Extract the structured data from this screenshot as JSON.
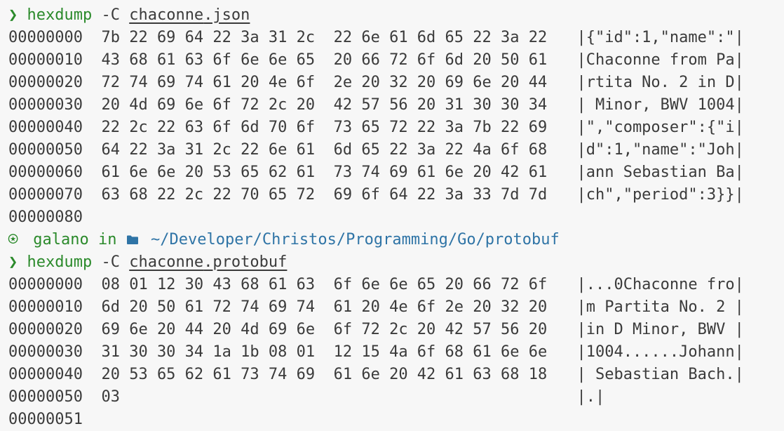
{
  "prompt_symbol": "❯",
  "commands": [
    {
      "cmd": "hexdump",
      "flag": "-C",
      "file_base": "chaconne",
      "file_ext": ".json"
    },
    {
      "cmd": "hexdump",
      "flag": "-C",
      "file_base": "chaconne",
      "file_ext": ".protobuf"
    }
  ],
  "prompt_context": {
    "user_icon": "user-circle-icon",
    "user": "galano",
    "in_word": "in",
    "folder_icon": "folder-icon",
    "path": "~/Developer/Christos/Programming/Go/protobuf"
  },
  "json_dump": [
    {
      "off": "00000000",
      "hex": "7b 22 69 64 22 3a 31 2c  22 6e 61 6d 65 22 3a 22",
      "ascii": "|{\"id\":1,\"name\":\"|"
    },
    {
      "off": "00000010",
      "hex": "43 68 61 63 6f 6e 6e 65  20 66 72 6f 6d 20 50 61",
      "ascii": "|Chaconne from Pa|"
    },
    {
      "off": "00000020",
      "hex": "72 74 69 74 61 20 4e 6f  2e 20 32 20 69 6e 20 44",
      "ascii": "|rtita No. 2 in D|"
    },
    {
      "off": "00000030",
      "hex": "20 4d 69 6e 6f 72 2c 20  42 57 56 20 31 30 30 34",
      "ascii": "| Minor, BWV 1004|"
    },
    {
      "off": "00000040",
      "hex": "22 2c 22 63 6f 6d 70 6f  73 65 72 22 3a 7b 22 69",
      "ascii": "|\",\"composer\":{\"i|"
    },
    {
      "off": "00000050",
      "hex": "64 22 3a 31 2c 22 6e 61  6d 65 22 3a 22 4a 6f 68",
      "ascii": "|d\":1,\"name\":\"Joh|"
    },
    {
      "off": "00000060",
      "hex": "61 6e 6e 20 53 65 62 61  73 74 69 61 6e 20 42 61",
      "ascii": "|ann Sebastian Ba|"
    },
    {
      "off": "00000070",
      "hex": "63 68 22 2c 22 70 65 72  69 6f 64 22 3a 33 7d 7d",
      "ascii": "|ch\",\"period\":3}}|"
    }
  ],
  "json_end_offset": "00000080",
  "protobuf_dump": [
    {
      "off": "00000000",
      "hex": "08 01 12 30 43 68 61 63  6f 6e 6e 65 20 66 72 6f",
      "ascii": "|...0Chaconne fro|"
    },
    {
      "off": "00000010",
      "hex": "6d 20 50 61 72 74 69 74  61 20 4e 6f 2e 20 32 20",
      "ascii": "|m Partita No. 2 |"
    },
    {
      "off": "00000020",
      "hex": "69 6e 20 44 20 4d 69 6e  6f 72 2c 20 42 57 56 20",
      "ascii": "|in D Minor, BWV |"
    },
    {
      "off": "00000030",
      "hex": "31 30 30 34 1a 1b 08 01  12 15 4a 6f 68 61 6e 6e",
      "ascii": "|1004......Johann|"
    },
    {
      "off": "00000040",
      "hex": "20 53 65 62 61 73 74 69  61 6e 20 42 61 63 68 18",
      "ascii": "| Sebastian Bach.|"
    },
    {
      "off": "00000050",
      "hex": "03",
      "ascii": "|.|"
    }
  ],
  "protobuf_end_offset": "00000051"
}
